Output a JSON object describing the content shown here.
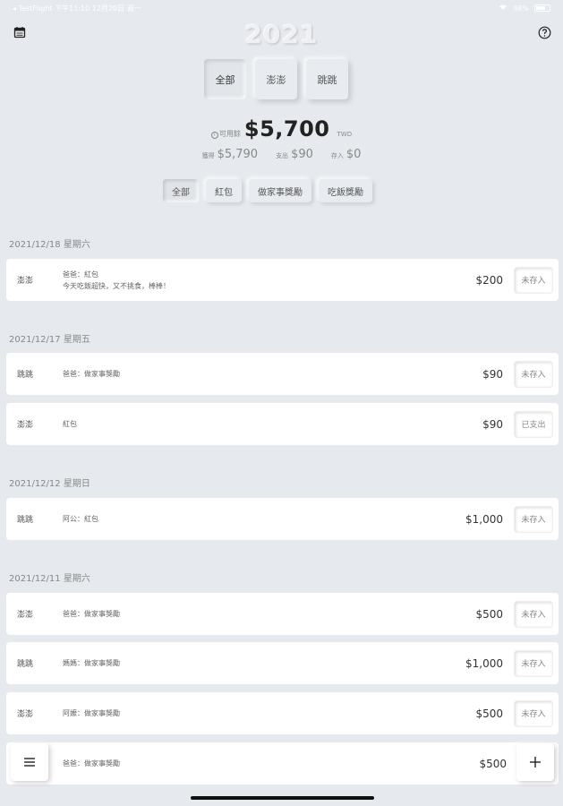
{
  "statusbar": {
    "left": "◂ TestFlight  下午11:10  12月20日 週一",
    "right": "98%"
  },
  "header": {
    "year": "2021"
  },
  "person_tabs": [
    {
      "label": "全部",
      "active": true
    },
    {
      "label": "澎澎",
      "active": false
    },
    {
      "label": "跳跳",
      "active": false
    }
  ],
  "balance": {
    "label": "可用餘",
    "info": "i",
    "amount": "$5,700",
    "unit": "TWD"
  },
  "summary": {
    "income_label": "獲得",
    "income_value": "$5,790",
    "spent_label": "支出",
    "spent_value": "$90",
    "saved_label": "存入",
    "saved_value": "$0"
  },
  "category_tabs": [
    {
      "label": "全部",
      "active": true
    },
    {
      "label": "紅包",
      "active": false
    },
    {
      "label": "做家事獎勵",
      "active": false
    },
    {
      "label": "吃飯獎勵",
      "active": false
    }
  ],
  "groups": [
    {
      "date": "2021/12/18 星期六",
      "entries": [
        {
          "person": "澎澎",
          "desc": "爸爸：紅包",
          "note": "今天吃飯超快，又不挑食，棒棒！",
          "amount": "$200",
          "status": "未存入"
        }
      ]
    },
    {
      "date": "2021/12/17 星期五",
      "entries": [
        {
          "person": "跳跳",
          "desc": "爸爸：做家事獎勵",
          "note": "",
          "amount": "$90",
          "status": "未存入"
        },
        {
          "person": "澎澎",
          "desc": "紅包",
          "note": "",
          "amount": "$90",
          "status": "已支出"
        }
      ]
    },
    {
      "date": "2021/12/12 星期日",
      "entries": [
        {
          "person": "跳跳",
          "desc": "阿公：紅包",
          "note": "",
          "amount": "$1,000",
          "status": "未存入"
        }
      ]
    },
    {
      "date": "2021/12/11 星期六",
      "entries": [
        {
          "person": "澎澎",
          "desc": "爸爸：做家事獎勵",
          "note": "",
          "amount": "$500",
          "status": "未存入"
        },
        {
          "person": "跳跳",
          "desc": "媽媽：做家事獎勵",
          "note": "",
          "amount": "$1,000",
          "status": "未存入"
        },
        {
          "person": "澎澎",
          "desc": "阿嬤：做家事獎勵",
          "note": "",
          "amount": "$500",
          "status": "未存入"
        },
        {
          "person": "",
          "desc": "爸爸：做家事獎勵",
          "note": "",
          "amount": "$500",
          "status": ""
        }
      ]
    }
  ],
  "icons": {
    "calendar": "calendar-icon",
    "help": "help-circle-icon",
    "menu": "menu-icon",
    "add": "plus-icon"
  }
}
